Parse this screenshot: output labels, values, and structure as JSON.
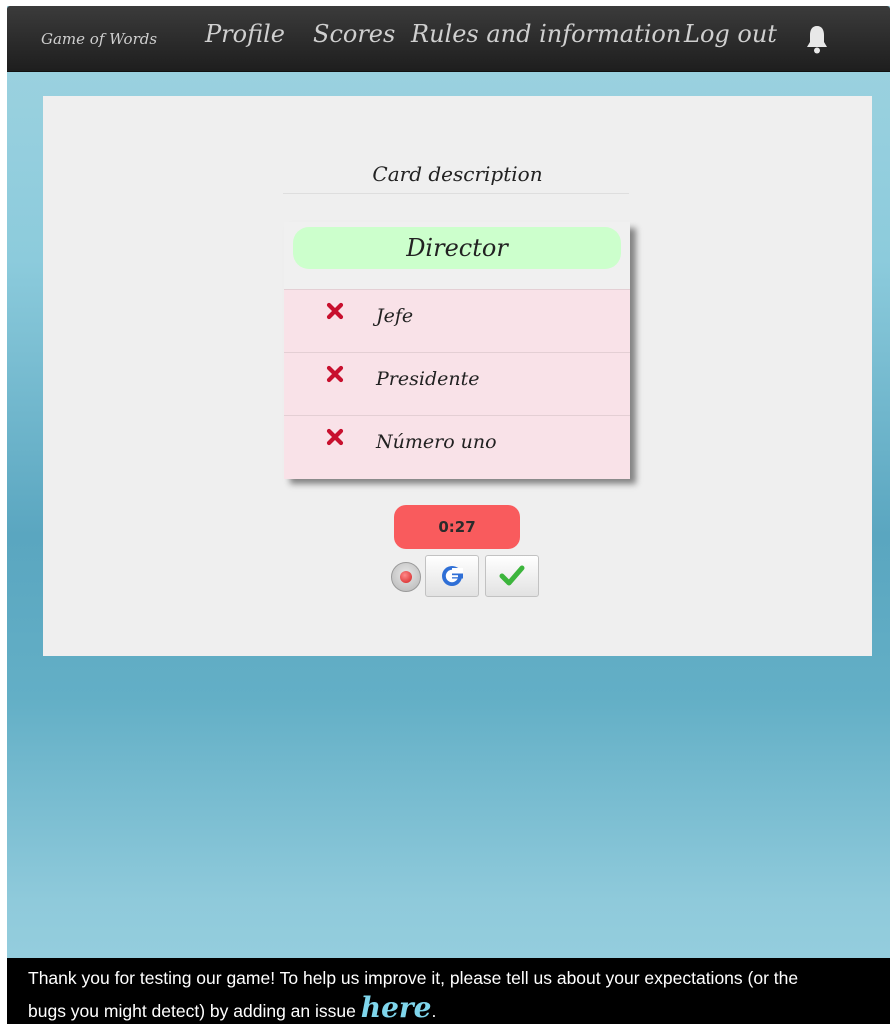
{
  "navbar": {
    "brand": "Game of Words",
    "items": [
      "Profile",
      "Scores",
      "Rules and information",
      "Log out"
    ],
    "notification_icon": "bell-icon"
  },
  "card": {
    "heading": "Card description",
    "word": "Director",
    "forbidden_icon": "cross-icon",
    "forbidden_words": [
      "Jefe",
      "Presidente",
      "Número uno"
    ]
  },
  "controls": {
    "timer": "0:27",
    "record_icon": "record-icon",
    "reset_icon": "refresh-icon",
    "confirm_icon": "checkmark-icon"
  },
  "footer": {
    "message": "Thank you for testing our game! To help us improve it, please tell us about your expectations (or the bugs you might detect) by adding an issue ",
    "link_label": "here",
    "trailing": "."
  },
  "colors": {
    "navbar": "#2b2b2b",
    "word_pill": "#ccffcc",
    "forbidden_row": "#f9e2e8",
    "timer": "#f95b5d",
    "cross": "#c8102e",
    "check": "#3cb53c",
    "link": "#7fd6ec"
  }
}
